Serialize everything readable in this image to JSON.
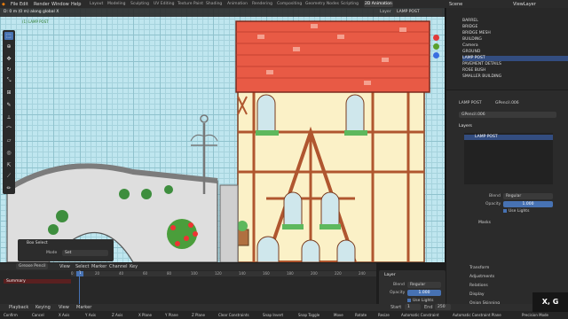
{
  "menus": [
    "File",
    "Edit",
    "Render",
    "Window",
    "Help"
  ],
  "workspaces": [
    "Layout",
    "Modeling",
    "Sculpting",
    "UV Editing",
    "Texture Paint",
    "Shading",
    "Animation",
    "Rendering",
    "Compositing",
    "Geometry Nodes",
    "Scripting",
    "2D Animation"
  ],
  "active_workspace": "2D Animation",
  "scene": "Scene",
  "view_layer": "ViewLayer",
  "viewport": {
    "info": "D: 0 m (0 m) along global X",
    "layer_label": "Layer",
    "layer_value": "LAMP POST",
    "object_info": "(1) LAMP POST"
  },
  "box_select": {
    "title": "Box Select",
    "mode_label": "Mode",
    "mode_value": "Set"
  },
  "outliner_items": [
    "BARREL",
    "BRIDGE",
    "BRIDGE MESH",
    "BUILDING",
    "Camera",
    "GROUND",
    "LAMP POST",
    "PAVEMENT DETAILS",
    "ROSE BUSH",
    "SMALLER BUILDING"
  ],
  "properties": {
    "object": "LAMP POST",
    "data": "GPencil.006",
    "datablock": "GPencil.006",
    "layers_title": "Layers",
    "layer_item": "LAMP POST",
    "blend_label": "Blend",
    "blend_value": "Regular",
    "opacity_label": "Opacity",
    "opacity_value": "1.000",
    "use_lights": "Use Lights",
    "masks": "Masks",
    "sections": [
      "Transform",
      "Adjustments",
      "Relations",
      "Display",
      "Onion Skinning"
    ]
  },
  "timeline": {
    "mode": "Grease Pencil",
    "menus": [
      "View",
      "Select",
      "Marker",
      "Channel",
      "Key"
    ],
    "channel": "Summary",
    "ticks": [
      "0",
      "20",
      "40",
      "60",
      "80",
      "100",
      "120",
      "140",
      "160",
      "180",
      "200",
      "220",
      "240"
    ],
    "current_frame": "1",
    "start_label": "Start",
    "start": "1",
    "end_label": "End",
    "end": "250",
    "playback": "Playback",
    "keying": "Keying",
    "view": "View",
    "marker": "Marker"
  },
  "tl_panel": {
    "title": "Layer",
    "blend_label": "Blend",
    "blend_value": "Regular",
    "opacity_label": "Opacity",
    "opacity_value": "1.000",
    "use_lights": "Use Lights"
  },
  "status": [
    "Confirm",
    "Cancel",
    "X Axis",
    "Y Axis",
    "Z Axis",
    "X Plane",
    "Y Plane",
    "Z Plane",
    "Clear Constraints",
    "Snap Invert",
    "Snap Toggle",
    "Move",
    "Rotate",
    "Resize",
    "Automatic Constraint",
    "Automatic Constraint Plane",
    "Precision Mode"
  ],
  "key_hint": "X, G"
}
